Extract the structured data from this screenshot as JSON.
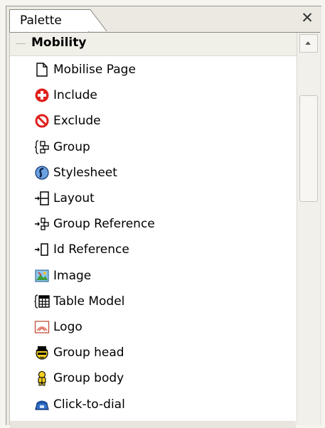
{
  "palette": {
    "tab_label": "Palette",
    "close_label": "✕",
    "section": {
      "title": "Mobility",
      "items": [
        {
          "label": "Mobilise Page",
          "icon": "page-icon"
        },
        {
          "label": "Include",
          "icon": "include-icon"
        },
        {
          "label": "Exclude",
          "icon": "exclude-icon"
        },
        {
          "label": "Group",
          "icon": "group-icon"
        },
        {
          "label": "Stylesheet",
          "icon": "stylesheet-icon"
        },
        {
          "label": "Layout",
          "icon": "layout-icon"
        },
        {
          "label": "Group Reference",
          "icon": "group-reference-icon"
        },
        {
          "label": "Id Reference",
          "icon": "id-reference-icon"
        },
        {
          "label": "Image",
          "icon": "image-icon"
        },
        {
          "label": "Table Model",
          "icon": "table-model-icon"
        },
        {
          "label": "Logo",
          "icon": "logo-icon"
        },
        {
          "label": "Group head",
          "icon": "group-head-icon"
        },
        {
          "label": "Group body",
          "icon": "group-body-icon"
        },
        {
          "label": "Click-to-dial",
          "icon": "click-to-dial-icon"
        }
      ]
    }
  },
  "colors": {
    "include_red": "#e0201c",
    "exclude_red": "#e0201c",
    "panel_bg": "#ffffff",
    "chrome_bg": "#ebe9e1"
  }
}
